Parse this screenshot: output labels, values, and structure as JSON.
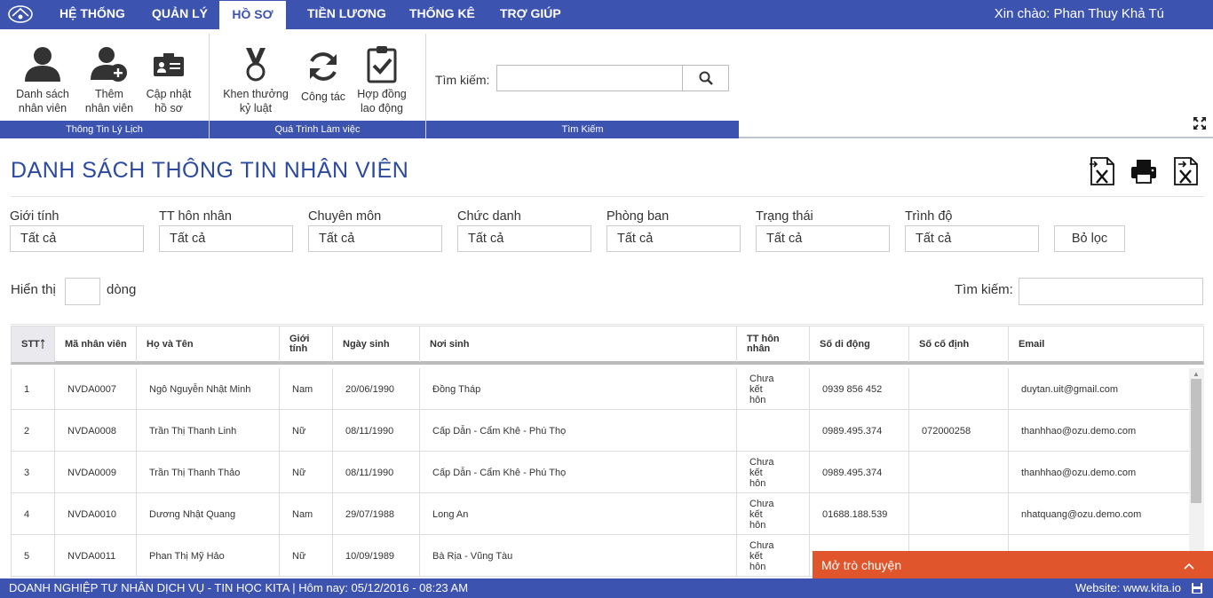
{
  "nav": {
    "items": [
      "HỆ THỐNG",
      "QUẢN LÝ",
      "HỒ SƠ",
      "TIỀN LƯƠNG",
      "THỐNG KÊ",
      "TRỢ GIÚP"
    ],
    "active": "HỒ SƠ",
    "greeting": "Xin chào: Phan Thuy Khả Tú"
  },
  "ribbon": {
    "groups": [
      {
        "label": "Thông Tin Lý Lịch",
        "buttons": [
          {
            "label1": "Danh sách",
            "label2": "nhân viên",
            "icon": "user-icon"
          },
          {
            "label1": "Thêm",
            "label2": "nhân viên",
            "icon": "add-user-icon"
          },
          {
            "label1": "Cập nhật",
            "label2": "hồ sơ",
            "icon": "id-card-icon"
          }
        ]
      },
      {
        "label": "Quá Trình Làm việc",
        "buttons": [
          {
            "label1": "Khen thưởng",
            "label2": "kỷ luật",
            "icon": "medal-icon"
          },
          {
            "label1": "Công tác",
            "label2": "",
            "icon": "refresh-icon"
          },
          {
            "label1": "Hợp đồng",
            "label2": "lao động",
            "icon": "clipboard-check-icon"
          }
        ]
      },
      {
        "label": "Tìm Kiếm"
      }
    ],
    "search_label": "Tìm kiếm:"
  },
  "page": {
    "title": "DANH SÁCH THÔNG TIN NHÂN VIÊN"
  },
  "filters": {
    "fields": [
      {
        "label": "Giới tính",
        "value": "Tất cả"
      },
      {
        "label": "TT hôn nhân",
        "value": "Tất cả"
      },
      {
        "label": "Chuyên môn",
        "value": "Tất cả"
      },
      {
        "label": "Chức danh",
        "value": "Tất cả"
      },
      {
        "label": "Phòng ban",
        "value": "Tất cả"
      },
      {
        "label": "Trạng thái",
        "value": "Tất cả"
      },
      {
        "label": "Trình độ",
        "value": "Tất cả"
      }
    ],
    "clear_label": "Bỏ lọc"
  },
  "table_controls": {
    "show_label": "Hiển thị",
    "rows_label": "dòng",
    "search_label": "Tìm kiếm:"
  },
  "table": {
    "headers": [
      "STT",
      "Mã nhân viên",
      "Họ và Tên",
      "Giới tính",
      "Ngày sinh",
      "Nơi sinh",
      "TT hôn nhân",
      "Số di động",
      "Số cố định",
      "Email"
    ],
    "rows": [
      [
        "1",
        "NVDA0007",
        "Ngô Nguyễn Nhật Minh",
        "Nam",
        "20/06/1990",
        "Đồng Tháp",
        "Chưa kết hôn",
        "0939 856 452",
        "",
        "duytan.uit@gmail.com"
      ],
      [
        "2",
        "NVDA0008",
        "Trần Thị Thanh Linh",
        "Nữ",
        "08/11/1990",
        "Cấp Dẫn - Cẩm Khê - Phú Thọ",
        "",
        "0989.495.374",
        "072000258",
        "thanhhao@ozu.demo.com"
      ],
      [
        "3",
        "NVDA0009",
        "Trần Thị Thanh Thảo",
        "Nữ",
        "08/11/1990",
        "Cấp Dẫn - Cẩm Khê - Phú Thọ",
        "Chưa kết hôn",
        "0989.495.374",
        "",
        "thanhhao@ozu.demo.com"
      ],
      [
        "4",
        "NVDA0010",
        "Dương Nhật Quang",
        "Nam",
        "29/07/1988",
        "Long An",
        "Chưa kết hôn",
        "01688.188.539",
        "",
        "nhatquang@ozu.demo.com"
      ],
      [
        "5",
        "NVDA0011",
        "Phan Thị Mỹ Hảo",
        "Nữ",
        "10/09/1989",
        "Bà Rịa - Vũng Tàu",
        "Chưa kết hôn",
        "",
        "",
        ""
      ]
    ]
  },
  "chat": {
    "label": "Mở trò chuyện"
  },
  "footer": {
    "left": "DOANH NGHIỆP TƯ NHÂN DỊCH VỤ - TIN HỌC KITA | Hôm nay: 05/12/2016 - 08:23 AM",
    "right": "Website: www.kita.io"
  },
  "colors": {
    "primary": "#3c53b0",
    "title": "#2c4aa0",
    "chat": "#e0552b"
  }
}
